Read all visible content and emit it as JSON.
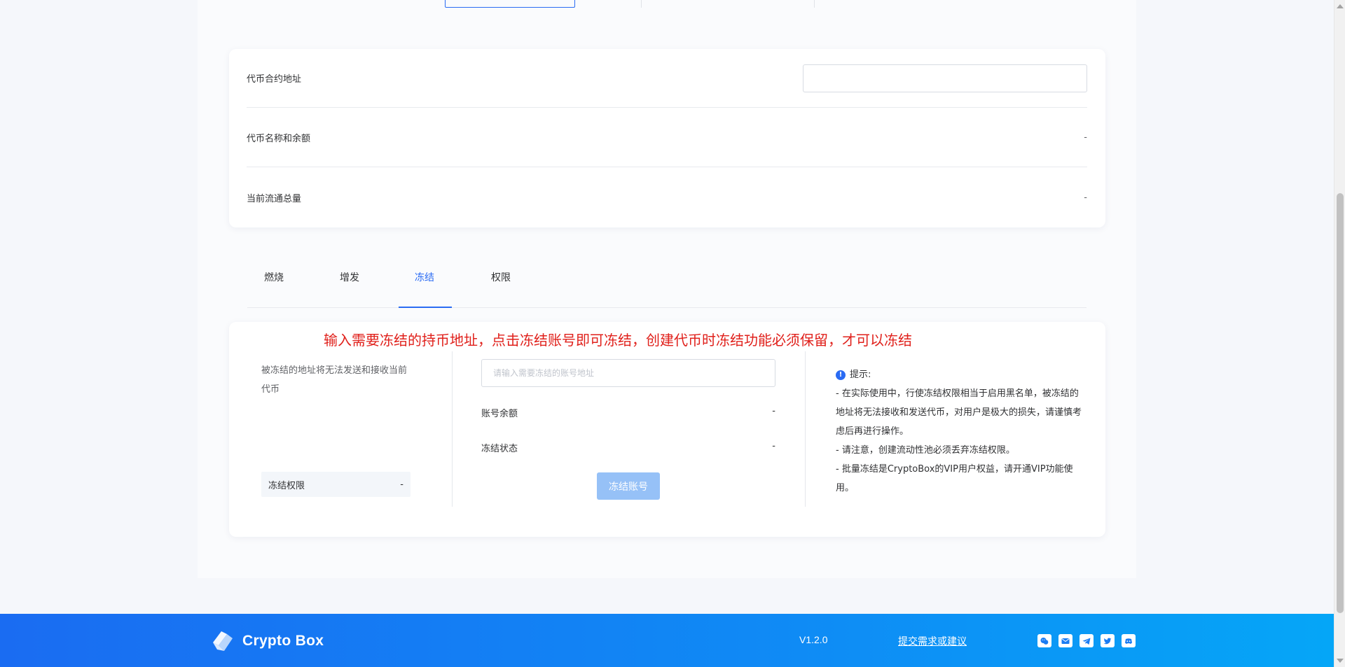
{
  "info": {
    "contract_address_label": "代币合约地址",
    "contract_address_value": "",
    "token_name_balance_label": "代币名称和余额",
    "token_name_balance_value": "-",
    "circulating_supply_label": "当前流通总量",
    "circulating_supply_value": "-"
  },
  "subtabs": [
    {
      "label": "燃烧",
      "active": false
    },
    {
      "label": "增发",
      "active": false
    },
    {
      "label": "冻结",
      "active": true
    },
    {
      "label": "权限",
      "active": false
    }
  ],
  "freeze": {
    "banner": "输入需要冻结的持币地址，点击冻结账号即可冻结，创建代币时冻结功能必须保留，才可以冻结",
    "description": "被冻结的地址将无法发送和接收当前代币",
    "permission_label": "冻结权限",
    "permission_value": "-",
    "address_placeholder": "请输入需要冻结的账号地址",
    "account_balance_label": "账号余额",
    "account_balance_value": "-",
    "freeze_status_label": "冻结状态",
    "freeze_status_value": "-",
    "button_label": "冻结账号",
    "tips_title": "提示:",
    "tips": [
      "- 在实际使用中，行使冻结权限相当于启用黑名单，被冻结的地址将无法接收和发送代币，对用户是极大的损失，请谨慎考虑后再进行操作。",
      "- 请注意，创建流动性池必须丢弃冻结权限。",
      "- 批量冻结是CryptoBox的VIP用户权益，请开通VIP功能使用。"
    ]
  },
  "footer": {
    "brand": "Crypto Box",
    "version": "V1.2.0",
    "suggest_link": "提交需求或建议",
    "social_icons": [
      "wechat-icon",
      "email-icon",
      "telegram-icon",
      "twitter-icon",
      "discord-icon"
    ]
  },
  "colors": {
    "accent": "#2a6bf3",
    "banner_red": "#e0201b",
    "button_disabled": "#96c1f7",
    "footer_start": "#1a6cf2",
    "footer_end": "#05a6f7"
  }
}
